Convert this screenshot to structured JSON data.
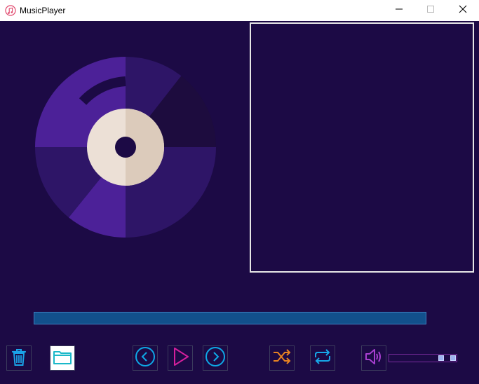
{
  "window": {
    "title": "MusicPlayer",
    "icon": "music-note-icon",
    "controls": [
      "minimize-icon",
      "maximize-icon",
      "close-icon"
    ]
  },
  "playback": {
    "progress_fraction": 1.0
  },
  "volume": {
    "level_fraction": 0.88
  },
  "toolbar": {
    "buttons": [
      "delete",
      "open-folder",
      "previous",
      "play",
      "next",
      "shuffle",
      "repeat",
      "volume"
    ]
  },
  "colors": {
    "background": "#1c0a45",
    "progress": "#12508c",
    "delete_icon": "#1aa3e8",
    "folder_icon": "#1bb8c9",
    "nav_icon": "#0ea8e6",
    "play_icon": "#d41f9c",
    "shuffle_icon": "#e88322",
    "repeat_icon": "#17a8e8",
    "volume_icon": "#a83fd0"
  }
}
